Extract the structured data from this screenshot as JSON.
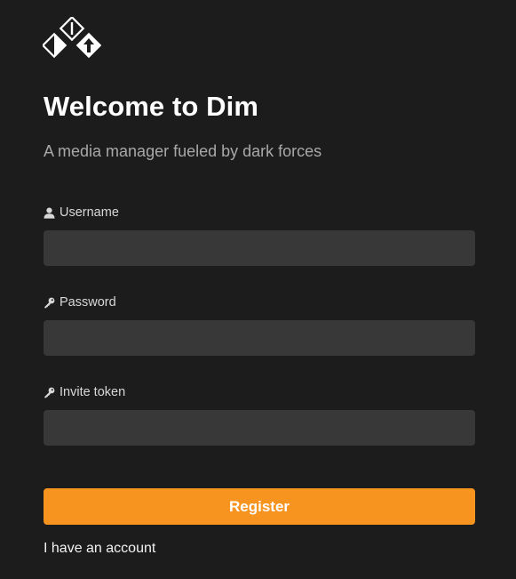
{
  "app": {
    "logo_icon": "dim-logo-icon",
    "title": "Welcome to Dim",
    "subtitle": "A media manager fueled by dark forces"
  },
  "form": {
    "username": {
      "label": "Username",
      "icon": "user-icon",
      "value": "",
      "placeholder": ""
    },
    "password": {
      "label": "Password",
      "icon": "key-icon",
      "value": "",
      "placeholder": ""
    },
    "invite_token": {
      "label": "Invite token",
      "icon": "key-icon",
      "value": "",
      "placeholder": ""
    },
    "register_label": "Register",
    "account_link": "I have an account"
  },
  "colors": {
    "background": "#1c1c1c",
    "input_background": "#383838",
    "accent": "#f7931f",
    "subtitle": "#a8a8a8"
  }
}
